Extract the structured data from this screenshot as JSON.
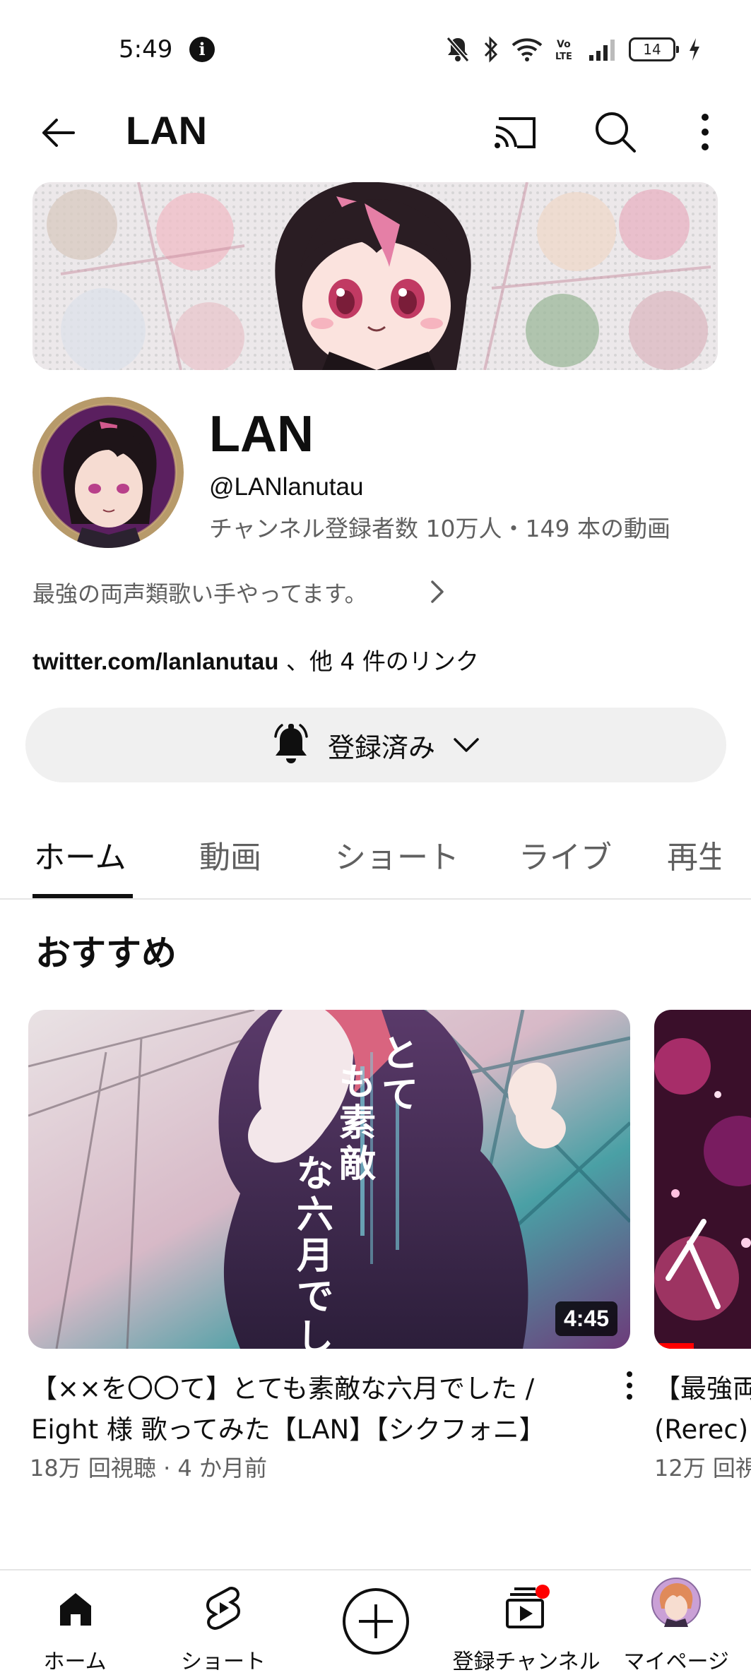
{
  "status_bar": {
    "time": "5:49",
    "battery": "14"
  },
  "header": {
    "title": "LAN"
  },
  "channel": {
    "name": "LAN",
    "handle": "@LANlanutau",
    "meta": "チャンネル登録者数 10万人・149 本の動画",
    "description": "最強の両声類歌い手やってます。",
    "link_main": "twitter.com/lanlanutau",
    "link_more": " 、他 4 件のリンク",
    "subscribe_label": "登録済み"
  },
  "tabs": [
    {
      "label": "ホーム",
      "active": true
    },
    {
      "label": "動画"
    },
    {
      "label": "ショート"
    },
    {
      "label": "ライブ"
    },
    {
      "label": "再生"
    }
  ],
  "section": {
    "title": "おすすめ"
  },
  "videos": [
    {
      "thumbnail_text": "とても素敵な六月でした",
      "duration": "4:45",
      "title": "【××を〇〇て】とても素敵な六月でした / Eight 様 歌ってみた【LAN】【シクフォニ】",
      "meta": "18万 回視聴 · 4 か月前"
    },
    {
      "title": "【最強両",
      "title_line2": "(Rerec)",
      "meta": "12万 回視",
      "progress": 0.35
    }
  ],
  "bottom_nav": [
    {
      "label": "ホーム",
      "icon": "home-icon",
      "active": true
    },
    {
      "label": "ショート",
      "icon": "shorts-icon"
    },
    {
      "label": "",
      "icon": "create-icon"
    },
    {
      "label": "登録チャンネル",
      "icon": "subscriptions-icon",
      "badge": true
    },
    {
      "label": "マイページ",
      "icon": "avatar-icon"
    }
  ],
  "colors": {
    "text": "#0f0f0f",
    "secondary": "#606060",
    "chip": "#f0f0f0",
    "accent_red": "#ff0000"
  }
}
